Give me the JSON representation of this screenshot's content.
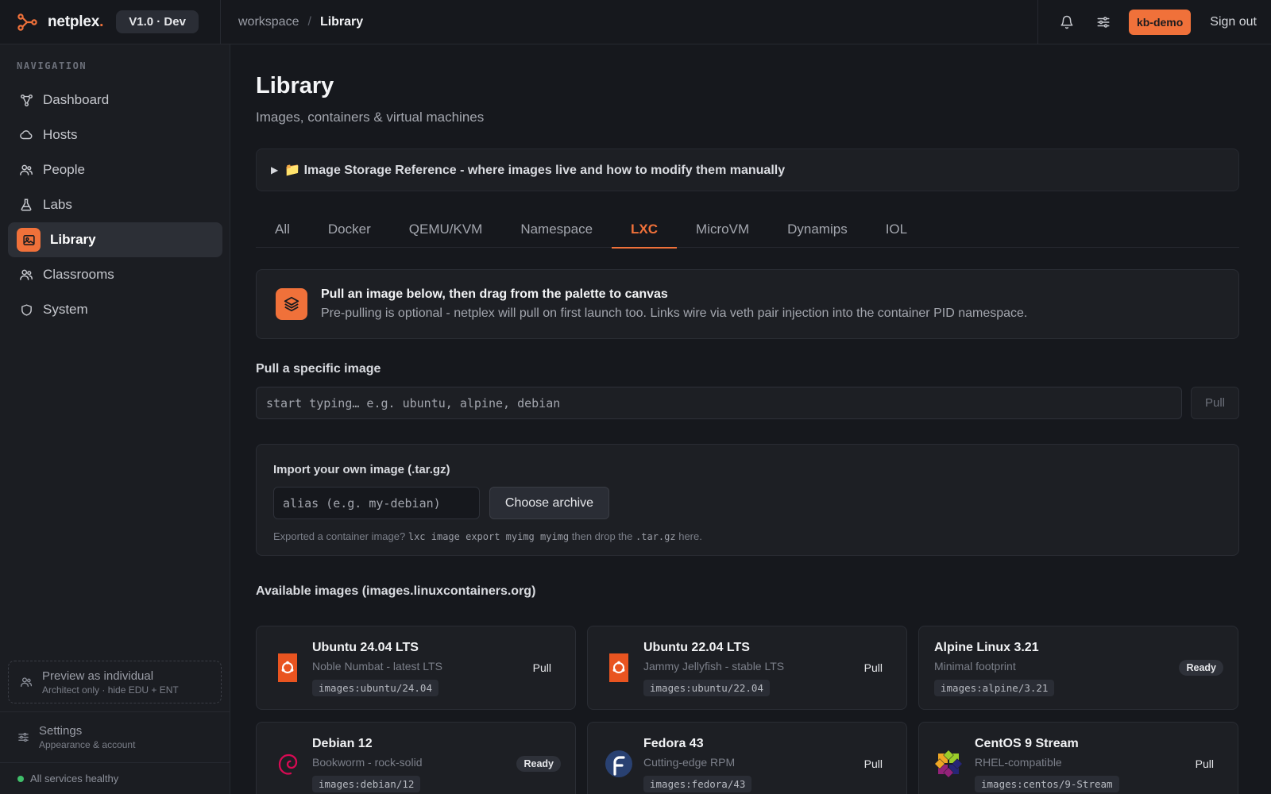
{
  "app": {
    "brand": "netplex",
    "brand_dot": ".",
    "version": "V1.0 · Dev",
    "user": "kb-demo",
    "signout": "Sign out",
    "accent": "#f0713a"
  },
  "breadcrumb": {
    "root": "workspace",
    "sep": "/",
    "current": "Library"
  },
  "sidebar": {
    "heading": "NAVIGATION",
    "items": [
      {
        "label": "Dashboard",
        "icon": "graph-icon"
      },
      {
        "label": "Hosts",
        "icon": "cloud-icon"
      },
      {
        "label": "People",
        "icon": "people-icon"
      },
      {
        "label": "Labs",
        "icon": "flask-icon"
      },
      {
        "label": "Library",
        "icon": "image-icon",
        "active": true
      },
      {
        "label": "Classrooms",
        "icon": "people-icon"
      },
      {
        "label": "System",
        "icon": "shield-icon"
      }
    ],
    "preview": {
      "title": "Preview as individual",
      "sub": "Architect only · hide EDU + ENT"
    },
    "settings": {
      "title": "Settings",
      "sub": "Appearance & account"
    },
    "health": "All services healthy"
  },
  "main": {
    "title": "Library",
    "subtitle": "Images, containers & virtual machines",
    "reference": "📁 Image Storage Reference - where images live and how to modify them manually",
    "tabs": [
      "All",
      "Docker",
      "QEMU/KVM",
      "Namespace",
      "LXC",
      "MicroVM",
      "Dynamips",
      "IOL"
    ],
    "active_tab": "LXC",
    "info": {
      "title": "Pull an image below, then drag from the palette to canvas",
      "body": "Pre-pulling is optional - netplex will pull on first launch too. Links wire via veth pair injection into the container PID namespace."
    },
    "pull": {
      "label": "Pull a specific image",
      "placeholder": "start typing… e.g. ubuntu, alpine, debian",
      "button": "Pull"
    },
    "import": {
      "title": "Import your own image (.tar.gz)",
      "alias_placeholder": "alias (e.g. my-debian)",
      "button": "Choose archive",
      "hint_pre": "Exported a container image?",
      "hint_cmd": "lxc image export myimg myimg",
      "hint_mid": "then drop the",
      "hint_ext": ".tar.gz",
      "hint_post": "here."
    },
    "available_label": "Available images (images.linuxcontainers.org)",
    "images": [
      {
        "name": "Ubuntu 24.04 LTS",
        "desc": "Noble Numbat - latest LTS",
        "tag": "images:ubuntu/24.04",
        "status": "Pull",
        "logo": "ubuntu-icon"
      },
      {
        "name": "Ubuntu 22.04 LTS",
        "desc": "Jammy Jellyfish - stable LTS",
        "tag": "images:ubuntu/22.04",
        "status": "Pull",
        "logo": "ubuntu-icon"
      },
      {
        "name": "Alpine Linux 3.21",
        "desc": "Minimal footprint",
        "tag": "images:alpine/3.21",
        "status": "Ready",
        "logo": ""
      },
      {
        "name": "Debian 12",
        "desc": "Bookworm - rock-solid",
        "tag": "images:debian/12",
        "status": "Ready",
        "logo": "debian-icon"
      },
      {
        "name": "Fedora 43",
        "desc": "Cutting-edge RPM",
        "tag": "images:fedora/43",
        "status": "Pull",
        "logo": "fedora-icon"
      },
      {
        "name": "CentOS 9 Stream",
        "desc": "RHEL-compatible",
        "tag": "images:centos/9-Stream",
        "status": "Pull",
        "logo": "centos-icon"
      }
    ]
  }
}
